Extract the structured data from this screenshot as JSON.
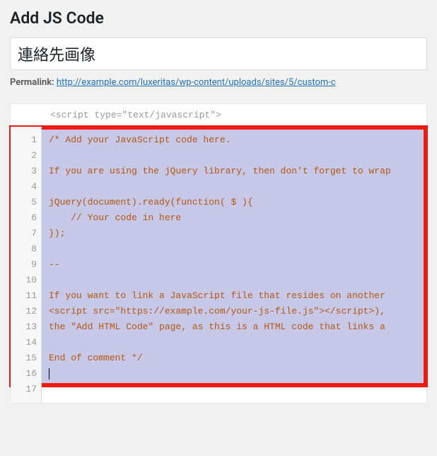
{
  "page_title": "Add JS Code",
  "title_input_value": "連絡先画像",
  "permalink": {
    "label": "Permalink:",
    "url_text": "http://example.com/luxeritas/wp-content/uploads/sites/5/custom-c"
  },
  "script_tag_header": "<script type=\"text/javascript\">",
  "code": {
    "lines": [
      "/* Add your JavaScript code here.",
      "",
      "If you are using the jQuery library, then don't forget to wrap",
      "",
      "jQuery(document).ready(function( $ ){",
      "    // Your code in here",
      "});",
      "",
      "--",
      "",
      "If you want to link a JavaScript file that resides on another ",
      "<script src=\"https://example.com/your-js-file.js\"></script>), ",
      "the \"Add HTML Code\" page, as this is a HTML code that links a",
      "",
      "End of comment */",
      "",
      ""
    ]
  },
  "line_numbers": [
    "1",
    "2",
    "3",
    "4",
    "5",
    "6",
    "7",
    "8",
    "9",
    "10",
    "11",
    "12",
    "13",
    "14",
    "15",
    "16",
    "17"
  ]
}
